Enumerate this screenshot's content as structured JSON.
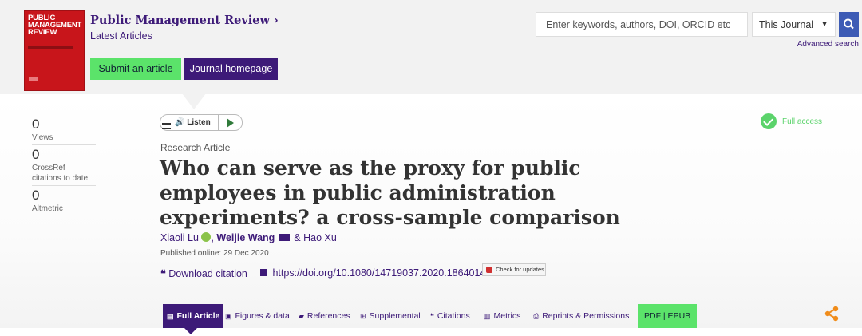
{
  "journal": {
    "cover_title": "PUBLIC MANAGEMENT REVIEW",
    "title": "Public Management Review ›",
    "subtitle": "Latest Articles",
    "submit_label": "Submit an article",
    "home_label": "Journal homepage",
    "cover_color": "#c8151b",
    "brand_purple": "#3d1a78"
  },
  "search": {
    "placeholder": "Enter keywords, authors, DOI, ORCID etc",
    "scope": "This Journal",
    "advanced_label": "Advanced search",
    "icon": "search-icon"
  },
  "metrics": [
    {
      "value": "0",
      "label": "Views"
    },
    {
      "value": "0",
      "label": "CrossRef citations to date"
    },
    {
      "value": "0",
      "label": "Altmetric"
    }
  ],
  "listen": {
    "label": "Listen"
  },
  "access": {
    "label": "Full access"
  },
  "article": {
    "type": "Research Article",
    "title": "Who can serve as the proxy for public employees in public administration experiments? a cross-sample comparison",
    "authors": {
      "a1": "Xiaoli Lu",
      "a2": "Weijie Wang",
      "a3": "& Hao Xu"
    },
    "published": "Published online: 29 Dec 2020",
    "download_label": "Download citation",
    "doi": "https://doi.org/10.1080/14719037.2020.1864014",
    "check_updates": "Check for updates"
  },
  "tabs": [
    {
      "label": "Full Article",
      "icon": "document-icon"
    },
    {
      "label": "Figures & data",
      "icon": "image-icon"
    },
    {
      "label": "References",
      "icon": "book-icon"
    },
    {
      "label": "Supplemental",
      "icon": "plus-icon"
    },
    {
      "label": "Citations",
      "icon": "quote-icon"
    },
    {
      "label": "Metrics",
      "icon": "bar-chart-icon"
    },
    {
      "label": "Reprints & Permissions",
      "icon": "print-icon"
    },
    {
      "label": "PDF | EPUB",
      "icon": ""
    }
  ]
}
